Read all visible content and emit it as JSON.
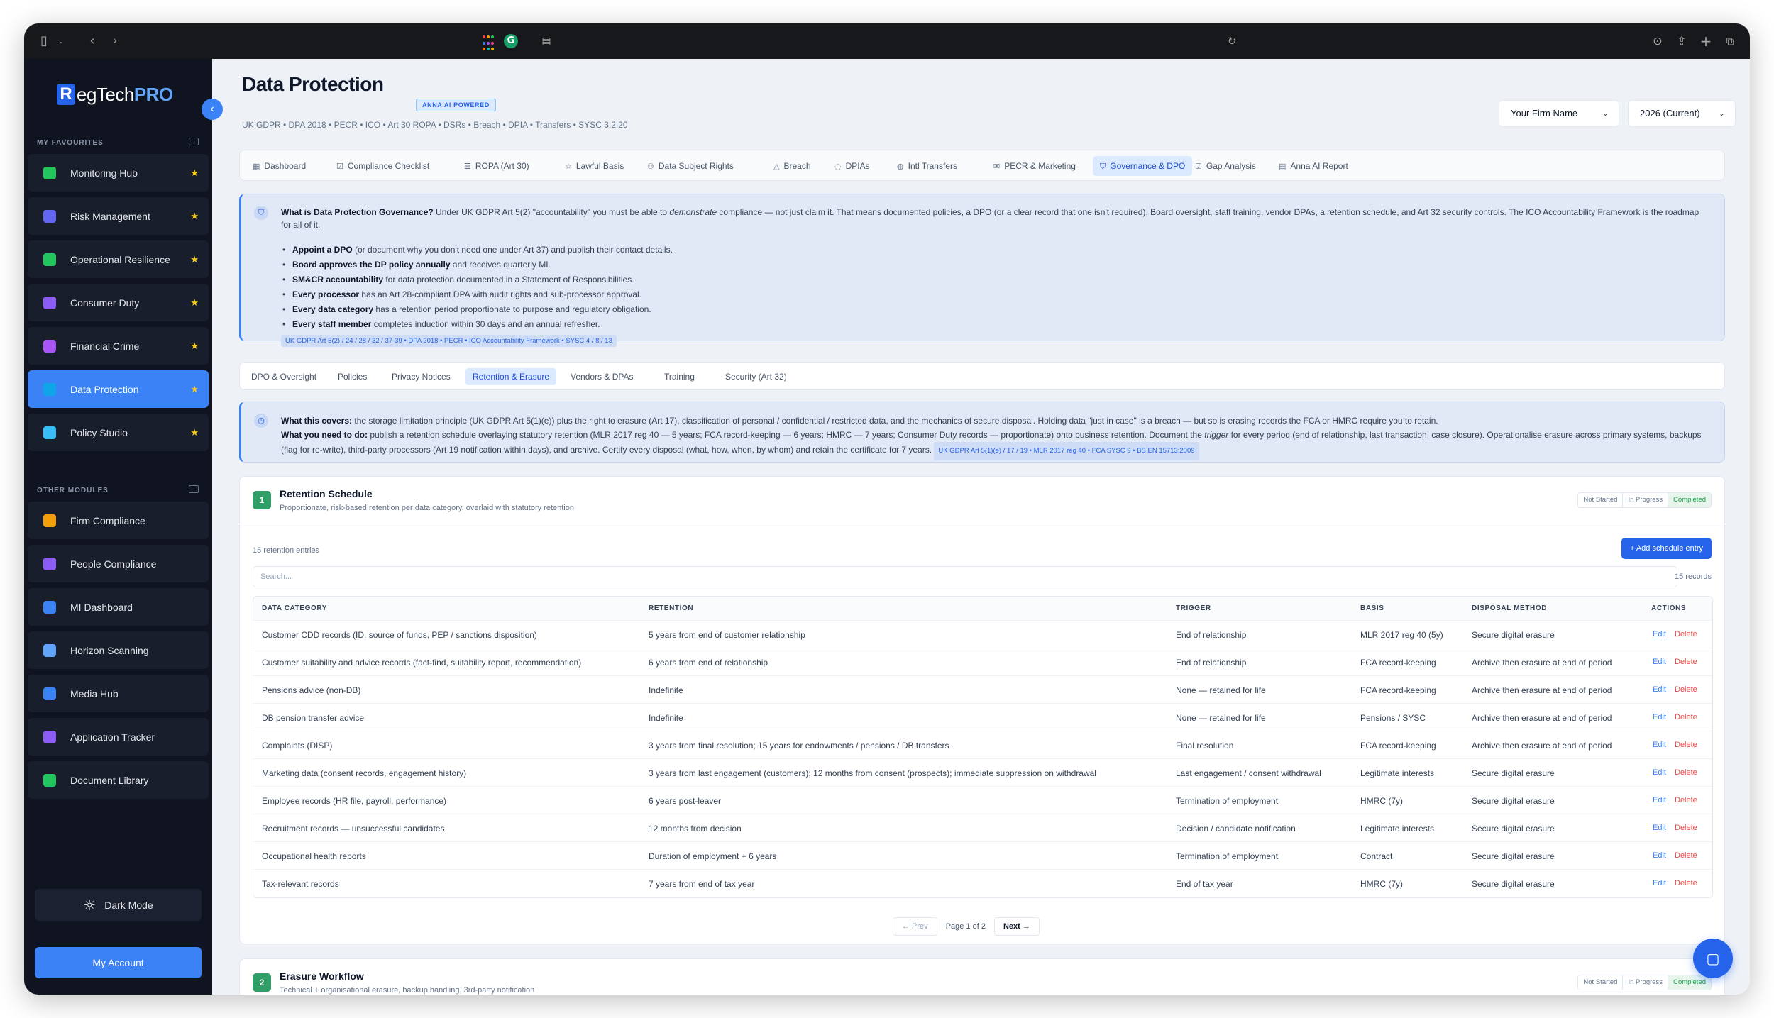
{
  "sidebar": {
    "logo": {
      "r": "R",
      "text": "egTech",
      "pro": "PRO"
    },
    "favourites_heading": "MY FAVOURITES",
    "other_heading": "OTHER MODULES",
    "favourites": [
      {
        "label": "Monitoring Hub",
        "star": "★",
        "color": "#22c55e"
      },
      {
        "label": "Risk Management",
        "star": "★",
        "color": "#6366f1"
      },
      {
        "label": "Operational Resilience",
        "star": "★",
        "color": "#22c55e"
      },
      {
        "label": "Consumer Duty",
        "star": "★",
        "color": "#8b5cf6"
      },
      {
        "label": "Financial Crime",
        "star": "★",
        "color": "#a855f7"
      },
      {
        "label": "Data Protection",
        "star": "★",
        "color": "#0ea5e9"
      },
      {
        "label": "Policy Studio",
        "star": "★",
        "color": "#38bdf8"
      }
    ],
    "others": [
      {
        "label": "Firm Compliance",
        "color": "#f59e0b"
      },
      {
        "label": "People Compliance",
        "color": "#8b5cf6"
      },
      {
        "label": "MI Dashboard",
        "color": "#3b82f6"
      },
      {
        "label": "Horizon Scanning",
        "color": "#60a5fa"
      },
      {
        "label": "Media Hub",
        "color": "#3b82f6"
      },
      {
        "label": "Application Tracker",
        "color": "#8b5cf6"
      },
      {
        "label": "Document Library",
        "color": "#22c55e"
      }
    ],
    "dark_mode": "Dark Mode",
    "my_account": "My Account"
  },
  "header": {
    "title": "Data Protection",
    "badge": "ANNA AI POWERED",
    "subtitle": "UK GDPR • DPA 2018 • PECR • ICO • Art 30 ROPA • DSRs • Breach • DPIA • Transfers • SYSC 3.2.20",
    "firm_select": "Your Firm Name",
    "year_select": "2026 (Current)"
  },
  "tabs": [
    {
      "icon": "▦",
      "label": "Dashboard"
    },
    {
      "icon": "☑",
      "label": "Compliance Checklist"
    },
    {
      "icon": "☰",
      "label": "ROPA (Art 30)"
    },
    {
      "icon": "☆",
      "label": "Lawful Basis"
    },
    {
      "icon": "⚇",
      "label": "Data Subject Rights"
    },
    {
      "icon": "△",
      "label": "Breach"
    },
    {
      "icon": "◌",
      "label": "DPIAs"
    },
    {
      "icon": "◍",
      "label": "Intl Transfers"
    },
    {
      "icon": "✉",
      "label": "PECR & Marketing"
    },
    {
      "icon": "⛉",
      "label": "Governance & DPO"
    },
    {
      "icon": "☑",
      "label": "Gap Analysis"
    },
    {
      "icon": "▤",
      "label": "Anna AI Report"
    }
  ],
  "governance_info": {
    "lead_bold": "What is Data Protection Governance?",
    "lead_1": " Under UK GDPR Art 5(2) \"accountability\" you must be able to ",
    "lead_em": "demonstrate",
    "lead_2": " compliance — not just claim it. That means documented policies, a DPO (or a clear record that one isn't required), Board oversight, staff training, vendor DPAs, a retention schedule, and Art 32 security controls. The ICO Accountability Framework is the roadmap for all of it.",
    "bullets": [
      {
        "b": "Appoint a DPO",
        "t": " (or document why you don't need one under Art 37) and publish their contact details."
      },
      {
        "b": "Board approves the DP policy annually",
        "t": " and receives quarterly MI."
      },
      {
        "b": "SM&CR accountability",
        "t": " for data protection documented in a Statement of Responsibilities."
      },
      {
        "b": "Every processor",
        "t": " has an Art 28-compliant DPA with audit rights and sub-processor approval."
      },
      {
        "b": "Every data category",
        "t": " has a retention period proportionate to purpose and regulatory obligation."
      },
      {
        "b": "Every staff member",
        "t": " completes induction within 30 days and an annual refresher."
      }
    ],
    "ref": "UK GDPR Art 5(2) / 24 / 28 / 32 / 37-39 • DPA 2018 • PECR • ICO Accountability Framework • SYSC 4 / 8 / 13"
  },
  "subtabs": [
    "DPO & Oversight",
    "Policies",
    "Privacy Notices",
    "Retention & Erasure",
    "Vendors & DPAs",
    "Training",
    "Security (Art 32)"
  ],
  "retention_info": {
    "covers_bold": "What this covers:",
    "covers": " the storage limitation principle (UK GDPR Art 5(1)(e)) plus the right to erasure (Art 17), classification of personal / confidential / restricted data, and the mechanics of secure disposal. Holding data \"just in case\" is a breach — but so is erasing records the FCA or HMRC require you to retain.",
    "todo_bold": "What you need to do:",
    "todo_1": " publish a retention schedule overlaying statutory retention (MLR 2017 reg 40 — 5 years; FCA record-keeping — 6 years; HMRC — 7 years; Consumer Duty records — proportionate) onto business retention. Document the ",
    "todo_em": "trigger",
    "todo_2": " for every period (end of relationship, last transaction, case closure). Operationalise erasure across primary systems, backups (flag for re-write), third-party processors (Art 19 notification within days), and archive. Certify every disposal (what, how, when, by whom) and retain the certificate for 7 years.",
    "ref": "UK GDPR Art 5(1)(e) / 17 / 19 • MLR 2017 reg 40 • FCA SYSC 9 • BS EN 15713:2009"
  },
  "retention_card": {
    "num": "1",
    "title": "Retention Schedule",
    "subtitle": "Proportionate, risk-based retention per data category, overlaid with statutory retention",
    "status": [
      "Not Started",
      "In Progress",
      "Completed"
    ],
    "count_label": "15 retention entries",
    "add_button": "+ Add schedule entry",
    "search_placeholder": "Search...",
    "records_label": "15 records",
    "columns": [
      "DATA CATEGORY",
      "RETENTION",
      "TRIGGER",
      "BASIS",
      "DISPOSAL METHOD",
      "ACTIONS"
    ],
    "rows": [
      [
        "Customer CDD records (ID, source of funds, PEP / sanctions disposition)",
        "5 years from end of customer relationship",
        "End of relationship",
        "MLR 2017 reg 40 (5y)",
        "Secure digital erasure"
      ],
      [
        "Customer suitability and advice records (fact-find, suitability report, recommendation)",
        "6 years from end of relationship",
        "End of relationship",
        "FCA record-keeping",
        "Archive then erasure at end of period"
      ],
      [
        "Pensions advice (non-DB)",
        "Indefinite",
        "None — retained for life",
        "FCA record-keeping",
        "Archive then erasure at end of period"
      ],
      [
        "DB pension transfer advice",
        "Indefinite",
        "None — retained for life",
        "Pensions / SYSC",
        "Archive then erasure at end of period"
      ],
      [
        "Complaints (DISP)",
        "3 years from final resolution; 15 years for endowments / pensions / DB transfers",
        "Final resolution",
        "FCA record-keeping",
        "Archive then erasure at end of period"
      ],
      [
        "Marketing data (consent records, engagement history)",
        "3 years from last engagement (customers); 12 months from consent (prospects); immediate suppression on withdrawal",
        "Last engagement / consent withdrawal",
        "Legitimate interests",
        "Secure digital erasure"
      ],
      [
        "Employee records (HR file, payroll, performance)",
        "6 years post-leaver",
        "Termination of employment",
        "HMRC (7y)",
        "Secure digital erasure"
      ],
      [
        "Recruitment records — unsuccessful candidates",
        "12 months from decision",
        "Decision / candidate notification",
        "Legitimate interests",
        "Secure digital erasure"
      ],
      [
        "Occupational health reports",
        "Duration of employment + 6 years",
        "Termination of employment",
        "Contract",
        "Secure digital erasure"
      ],
      [
        "Tax-relevant records",
        "7 years from end of tax year",
        "End of tax year",
        "HMRC (7y)",
        "Secure digital erasure"
      ]
    ],
    "edit": "Edit",
    "delete": "Delete",
    "prev": "← Prev",
    "page": "Page 1 of 2",
    "next": "Next →"
  },
  "erasure_card": {
    "num": "2",
    "title": "Erasure Workflow",
    "subtitle": "Technical + organisational erasure, backup handling, 3rd-party notification",
    "status": [
      "Not Started",
      "In Progress",
      "Completed"
    ]
  },
  "icons": {
    "chat": "chat-icon",
    "collapse": "chevron-left-icon",
    "sun": "sun-icon"
  }
}
